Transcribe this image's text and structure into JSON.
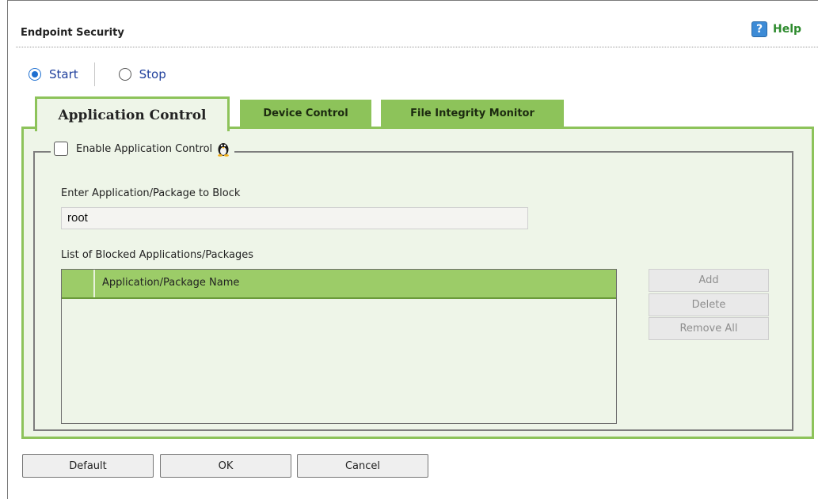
{
  "header": {
    "title": "Endpoint Security",
    "help_label": "Help"
  },
  "service_state": {
    "start_label": "Start",
    "stop_label": "Stop",
    "selected": "Start"
  },
  "tabs": [
    {
      "label": "Application Control",
      "active": true
    },
    {
      "label": "Device Control",
      "active": false
    },
    {
      "label": "File Integrity Monitor",
      "active": false
    }
  ],
  "app_control": {
    "enable_label": "Enable Application Control",
    "enabled": false,
    "input_label": "Enter Application/Package to Block",
    "input_value": "root",
    "list_label": "List of Blocked Applications/Packages",
    "column_header": "Application/Package Name",
    "rows": [],
    "buttons": {
      "add": "Add",
      "delete": "Delete",
      "remove_all": "Remove All"
    }
  },
  "footer": {
    "default_label": "Default",
    "ok_label": "OK",
    "cancel_label": "Cancel"
  },
  "colors": {
    "tab_green": "#8dc35a",
    "panel_bg": "#eef5e8",
    "radio_blue": "#1e6fd0",
    "help_green": "#2e8b2e"
  },
  "icons": {
    "help": "help-icon",
    "os": "linux-tux-icon"
  }
}
